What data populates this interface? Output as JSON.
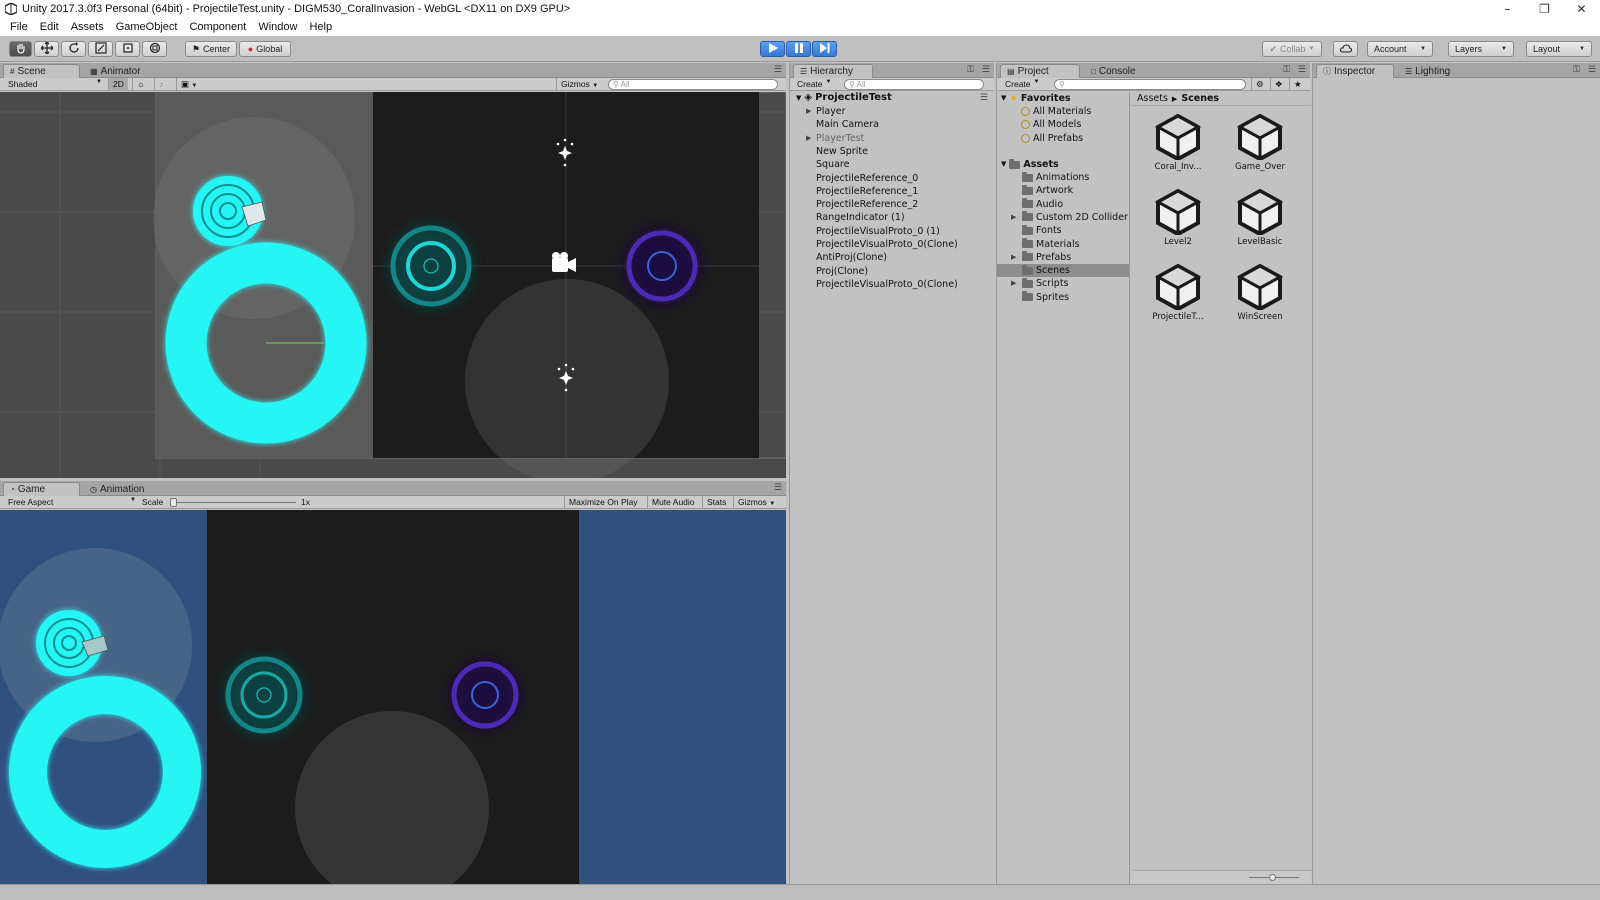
{
  "window": {
    "title": "Unity 2017.3.0f3 Personal (64bit) - ProjectileTest.unity - DIGM530_CoralInvasion - WebGL <DX11 on DX9 GPU>",
    "minimize": "–",
    "restore": "❐",
    "close": "✕"
  },
  "menu": [
    "File",
    "Edit",
    "Assets",
    "GameObject",
    "Component",
    "Window",
    "Help"
  ],
  "toolbar": {
    "pivot": "Center",
    "space": "Global",
    "collab": "Collab",
    "account": "Account",
    "layers": "Layers",
    "layout": "Layout"
  },
  "scene_panel": {
    "tabs": [
      "Scene",
      "Animator"
    ],
    "shading": "Shaded",
    "mode_2d": "2D",
    "gizmos": "Gizmos",
    "search_placeholder": "All"
  },
  "game_panel": {
    "tabs": [
      "Game",
      "Animation"
    ],
    "aspect": "Free Aspect",
    "scale_label": "Scale",
    "scale_value": "1x",
    "scale_fraction": 0.0,
    "buttons": [
      "Maximize On Play",
      "Mute Audio",
      "Stats",
      "Gizmos"
    ]
  },
  "hierarchy": {
    "tab": "Hierarchy",
    "create": "Create",
    "search_placeholder": "All",
    "scene_name": "ProjectileTest",
    "items": [
      {
        "label": "Player",
        "arrow": true,
        "dim": false
      },
      {
        "label": "Main Camera",
        "arrow": false,
        "dim": false
      },
      {
        "label": "PlayerTest",
        "arrow": true,
        "dim": true
      },
      {
        "label": "New Sprite",
        "arrow": false,
        "dim": false
      },
      {
        "label": "Square",
        "arrow": false,
        "dim": false
      },
      {
        "label": "ProjectileReference_0",
        "arrow": false,
        "dim": false
      },
      {
        "label": "ProjectileReference_1",
        "arrow": false,
        "dim": false
      },
      {
        "label": "ProjectileReference_2",
        "arrow": false,
        "dim": false
      },
      {
        "label": "RangeIndicator (1)",
        "arrow": false,
        "dim": false
      },
      {
        "label": "ProjectileVisualProto_0 (1)",
        "arrow": false,
        "dim": false
      },
      {
        "label": "ProjectileVisualProto_0(Clone)",
        "arrow": false,
        "dim": false
      },
      {
        "label": "AntiProj(Clone)",
        "arrow": false,
        "dim": false
      },
      {
        "label": "Proj(Clone)",
        "arrow": false,
        "dim": false
      },
      {
        "label": "ProjectileVisualProto_0(Clone)",
        "arrow": false,
        "dim": false
      }
    ]
  },
  "project": {
    "tabs": [
      "Project",
      "Console"
    ],
    "create": "Create",
    "favorites_label": "Favorites",
    "favorites": [
      "All Materials",
      "All Models",
      "All Prefabs"
    ],
    "assets_label": "Assets",
    "folders": [
      {
        "label": "Animations",
        "arrow": false,
        "selected": false
      },
      {
        "label": "Artwork",
        "arrow": false,
        "selected": false
      },
      {
        "label": "Audio",
        "arrow": false,
        "selected": false
      },
      {
        "label": "Custom 2D Collider",
        "arrow": true,
        "selected": false
      },
      {
        "label": "Fonts",
        "arrow": false,
        "selected": false
      },
      {
        "label": "Materials",
        "arrow": false,
        "selected": false
      },
      {
        "label": "Prefabs",
        "arrow": true,
        "selected": false
      },
      {
        "label": "Scenes",
        "arrow": false,
        "selected": true
      },
      {
        "label": "Scripts",
        "arrow": true,
        "selected": false
      },
      {
        "label": "Sprites",
        "arrow": false,
        "selected": false
      }
    ],
    "breadcrumb": [
      "Assets",
      "Scenes"
    ],
    "scene_assets": [
      "Coral_Inv...",
      "Game_Over",
      "Level2",
      "LevelBasic",
      "ProjectileT...",
      "WinScreen"
    ]
  },
  "inspector": {
    "tabs": [
      "Inspector",
      "Lighting"
    ]
  },
  "colors": {
    "cyan": "#28f5f5",
    "teal_ring": "#19c2c2",
    "purple_ring": "#4b2ab8",
    "scene_bg": "#4a4a4a",
    "game_blue": "#30507e",
    "dark_area": "#1c1c1c",
    "selection": "#8e8e8e"
  }
}
